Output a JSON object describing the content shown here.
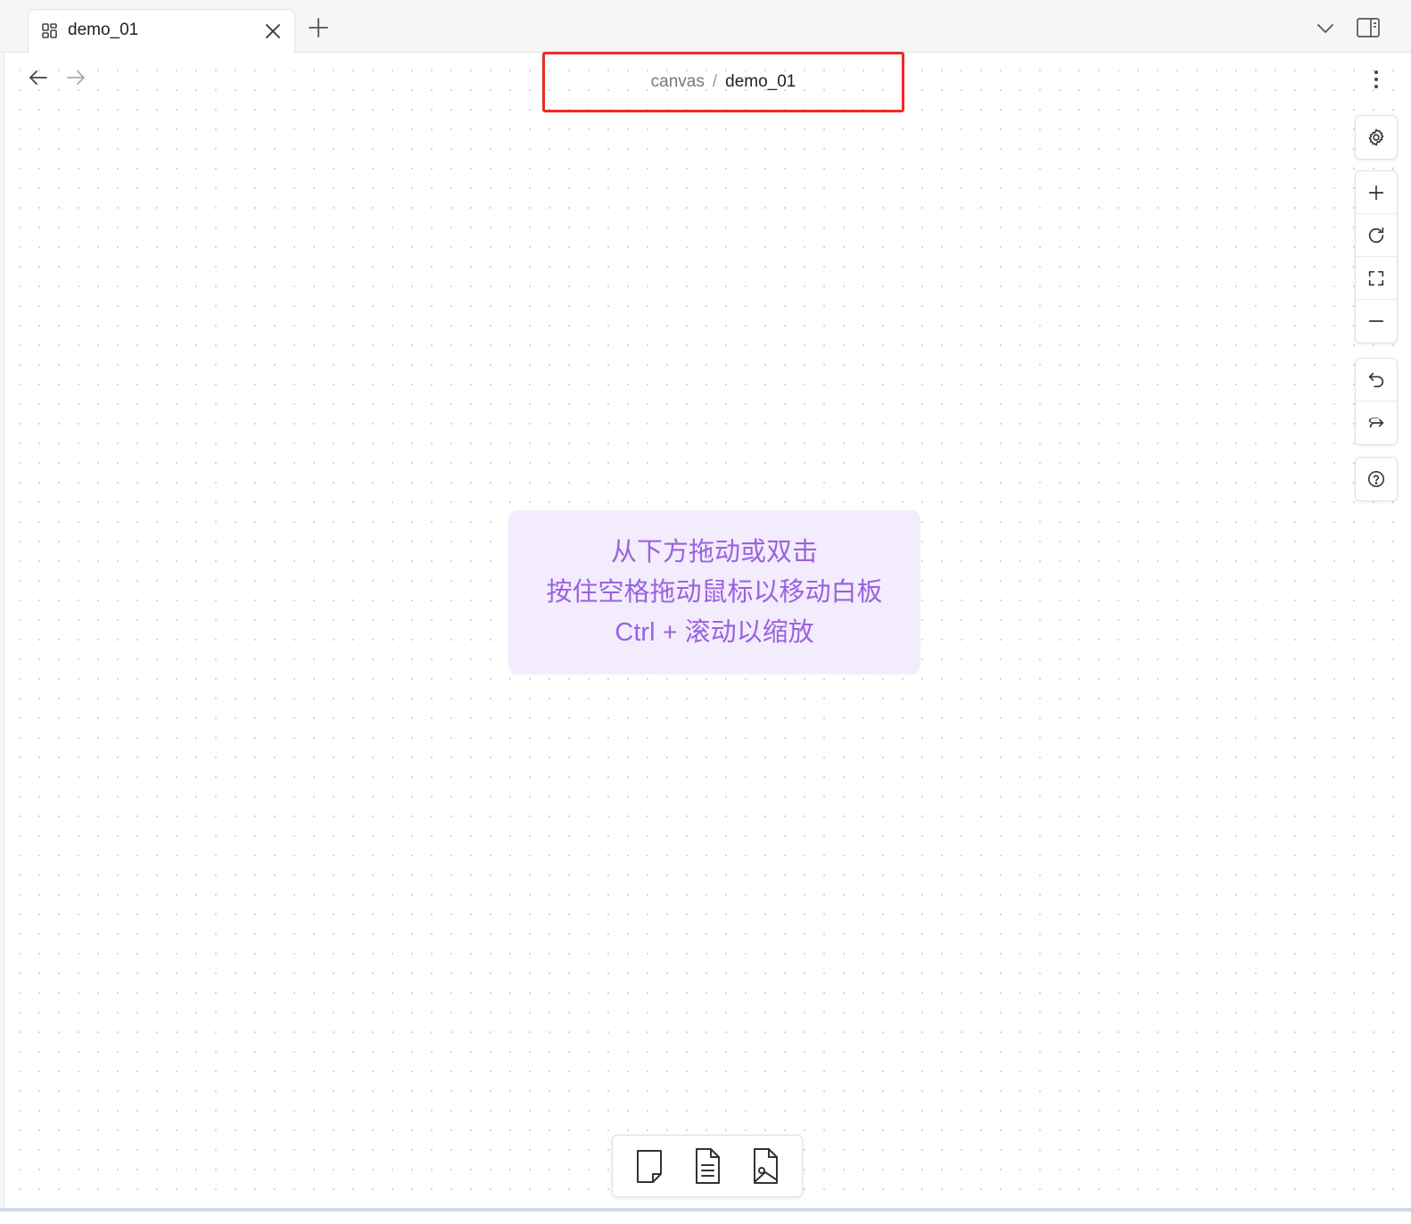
{
  "tab": {
    "label": "demo_01",
    "icon": "canvas-grid-icon"
  },
  "breadcrumb": {
    "parent": "canvas",
    "separator": "/",
    "current": "demo_01"
  },
  "hint": {
    "line1": "从下方拖动或双击",
    "line2": "按住空格拖动鼠标以移动白板",
    "line3": "Ctrl + 滚动以缩放"
  },
  "controls": {
    "settings": "gear-icon",
    "zoom_in": "plus-icon",
    "reset": "rotate-icon",
    "fit": "fullscreen-icon",
    "zoom_out": "minus-icon",
    "undo": "undo-icon",
    "redo": "redo-icon",
    "help": "help-circle-icon"
  },
  "bottom_tools": [
    "card-icon",
    "note-file-icon",
    "image-file-icon"
  ],
  "colors": {
    "highlight_border": "#ee2a24",
    "hint_background": "#f3ecfc",
    "hint_text": "#9a62e0"
  }
}
